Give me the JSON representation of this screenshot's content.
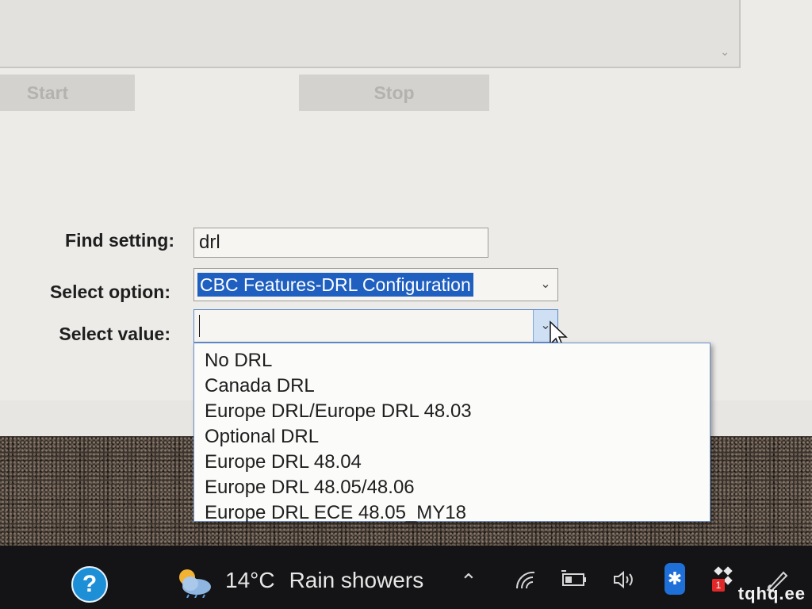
{
  "toolbar": {
    "start_label": "Start",
    "stop_label": "Stop"
  },
  "form": {
    "find_label": "Find setting:",
    "find_value": "drl",
    "option_label": "Select option:",
    "option_value": "CBC Features-DRL Configuration",
    "value_label": "Select value:",
    "value_value": ""
  },
  "dropdown": {
    "items": [
      "No DRL",
      "Canada DRL",
      "Europe DRL/Europe DRL 48.03",
      "Optional DRL",
      "Europe DRL 48.04",
      "Europe DRL 48.05/48.06",
      "Europe DRL ECE 48.05_MY18"
    ]
  },
  "taskbar": {
    "help_symbol": "?",
    "weather_temp": "14°C",
    "weather_desc": "Rain showers",
    "badge_count": "1",
    "icons": [
      "help-icon",
      "cloud-sun-icon",
      "chevron-up-icon",
      "wifi-icon",
      "battery-icon",
      "volume-icon",
      "bluetooth-icon",
      "app-tray-icon",
      "pen-icon"
    ]
  },
  "watermark": "tqhq.ee",
  "colors": {
    "selection": "#1f5fbf",
    "window_bg": "#ecebe8",
    "taskbar_bg": "#141416",
    "bluetooth": "#1e6fd8",
    "help": "#1d8fd6"
  }
}
